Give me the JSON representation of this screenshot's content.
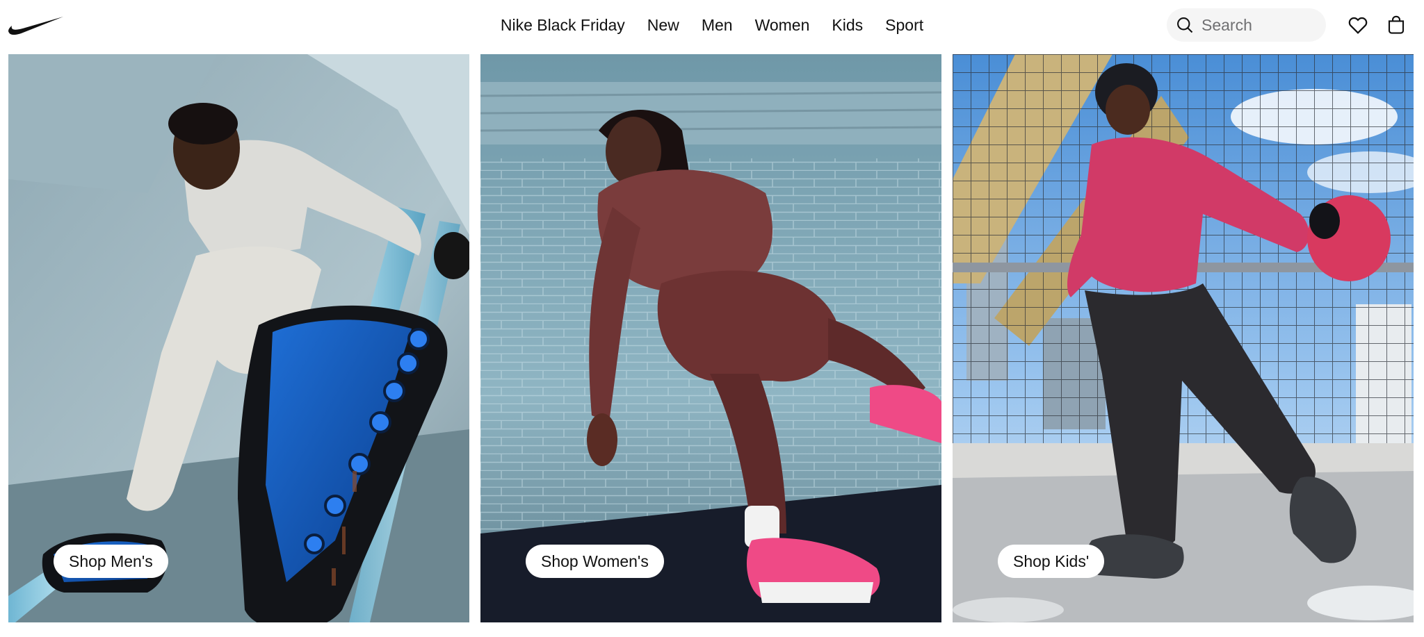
{
  "brand": {
    "logo_icon": "nike-swoosh-icon"
  },
  "nav": {
    "items": [
      {
        "label": "Nike Black Friday"
      },
      {
        "label": "New"
      },
      {
        "label": "Men"
      },
      {
        "label": "Women"
      },
      {
        "label": "Kids"
      },
      {
        "label": "Sport"
      }
    ]
  },
  "search": {
    "placeholder": "Search",
    "value": "",
    "icon": "search-icon"
  },
  "actions": {
    "favorites_icon": "heart-icon",
    "bag_icon": "shopping-bag-icon"
  },
  "panels": [
    {
      "cta": "Shop Men's",
      "scene": "man in light grey tracksuit and blue sneakers on stair railing"
    },
    {
      "cta": "Shop Women's",
      "scene": "woman in maroon outfit with pink sneakers lunging"
    },
    {
      "cta": "Shop Kids'",
      "scene": "girl in pink puffer jacket and dark pants walking by fence"
    }
  ],
  "colors": {
    "text": "#111111",
    "search_bg": "#f5f5f5",
    "placeholder": "#707072",
    "cta_bg": "#ffffff"
  }
}
